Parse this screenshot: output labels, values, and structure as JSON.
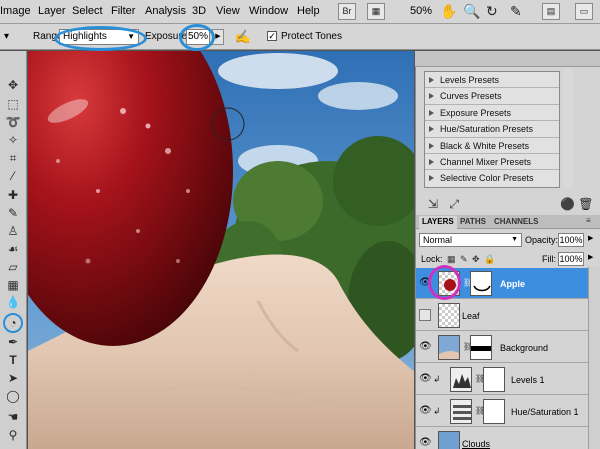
{
  "menubar": {
    "items": [
      "Image",
      "Layer",
      "Select",
      "Filter",
      "Analysis",
      "3D",
      "View",
      "Window",
      "Help"
    ],
    "bridge_label": "Br",
    "zoom": "50%",
    "glyphs": {
      "hand": "hand-icon",
      "zoom": "zoom-icon",
      "rotate": "rotate-view-icon",
      "arrange": "arrange-documents-icon",
      "screen": "screen-mode-icon"
    }
  },
  "options": {
    "range_label": "Range:",
    "range_value": "Highlights",
    "exposure_label": "Exposure:",
    "exposure_value": "50%",
    "protect_tones_label": "Protect Tones",
    "protect_tones_checked": true,
    "highlight_color": "#2b8fd8"
  },
  "toolbox": {
    "tools": [
      "move-tool-icon",
      "marquee-tool-icon",
      "lasso-tool-icon",
      "magic-wand-icon",
      "crop-tool-icon",
      "eyedropper-icon",
      "healing-brush-icon",
      "brush-tool-icon",
      "clone-stamp-icon",
      "history-brush-icon",
      "eraser-tool-icon",
      "gradient-tool-icon",
      "blur-tool-icon",
      "dodge-tool-icon",
      "pen-tool-icon",
      "type-tool-icon",
      "path-selection-icon",
      "shape-tool-icon",
      "hand-tool-icon"
    ]
  },
  "adjustments": {
    "presets": [
      "Levels Presets",
      "Curves Presets",
      "Exposure Presets",
      "Hue/Saturation Presets",
      "Black & White Presets",
      "Channel Mixer Presets",
      "Selective Color Presets"
    ]
  },
  "layers_panel": {
    "tabs": [
      "LAYERS",
      "PATHS",
      "CHANNELS"
    ],
    "blend_mode": "Normal",
    "opacity_label": "Opacity:",
    "opacity_value": "100%",
    "lock_label": "Lock:",
    "fill_label": "Fill:",
    "fill_value": "100%",
    "selected_color": "#3e8ee0",
    "layers": [
      {
        "name": "Apple",
        "visible": true,
        "selected": true
      },
      {
        "name": "Leaf",
        "visible": false,
        "selected": false
      },
      {
        "name": "Background",
        "visible": true,
        "selected": false
      },
      {
        "name": "Levels 1",
        "visible": true,
        "selected": false,
        "clipped": true
      },
      {
        "name": "Hue/Saturation 1",
        "visible": true,
        "selected": false,
        "clipped": true
      },
      {
        "name": "Clouds",
        "visible": true,
        "selected": false
      }
    ]
  },
  "canvas": {
    "description_colors": {
      "apple": "#a5121a",
      "sky": "#3c7fc0",
      "foliage": "#3b6a2a",
      "hand": "#e4cbb8"
    }
  }
}
